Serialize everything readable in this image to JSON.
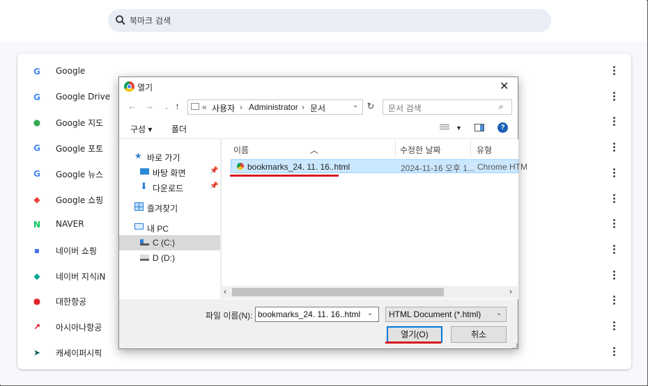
{
  "search": {
    "placeholder": "북마크 검색"
  },
  "bookmarks": [
    {
      "label": "Google",
      "icon": "google-icon",
      "glyph": "G",
      "color": "#4285f4"
    },
    {
      "label": "Google Drive",
      "icon": "google-icon",
      "glyph": "G",
      "color": "#4285f4"
    },
    {
      "label": "Google 지도",
      "icon": "google-maps-icon",
      "glyph": "●",
      "color": "#34a853"
    },
    {
      "label": "Google 포토",
      "icon": "google-icon",
      "glyph": "G",
      "color": "#4285f4"
    },
    {
      "label": "Google 뉴스",
      "icon": "google-news-icon",
      "glyph": "G",
      "color": "#4285f4"
    },
    {
      "label": "Google 쇼핑",
      "icon": "google-shopping-icon",
      "glyph": "◆",
      "color": "#ea4335"
    },
    {
      "label": "NAVER",
      "icon": "naver-icon",
      "glyph": "N",
      "color": "#03c75a"
    },
    {
      "label": "네이버 쇼핑",
      "icon": "naver-shopping-icon",
      "glyph": "▪",
      "color": "#4c6ef5"
    },
    {
      "label": "네이버 지식iN",
      "icon": "naver-kin-icon",
      "glyph": "◆",
      "color": "#00a495"
    },
    {
      "label": "대한항공",
      "icon": "korean-air-icon",
      "glyph": "●",
      "color": "#e0262f"
    },
    {
      "label": "아시아나항공",
      "icon": "asiana-icon",
      "glyph": "↗",
      "color": "#e60012"
    },
    {
      "label": "캐세이퍼시픽",
      "icon": "cathay-icon",
      "glyph": "➤",
      "color": "#006564"
    }
  ],
  "dialog": {
    "title": "열기",
    "breadcrumb": {
      "prefix": "«",
      "parts": [
        "사용자",
        "Administrator",
        "문서"
      ]
    },
    "search_placeholder": "문서 검색",
    "toolbar": {
      "organize": "구성 ▾",
      "new_folder": "폴더"
    },
    "nav": {
      "quick_access": "바로 가기",
      "desktop": "바탕 화면",
      "downloads": "다운로드",
      "favorites": "즐겨찾기",
      "this_pc": "내 PC",
      "drive_c": "C (C:)",
      "drive_d": "D (D:)"
    },
    "columns": {
      "name": "이름",
      "modified": "수정한 날짜",
      "type": "유형"
    },
    "file": {
      "name": "bookmarks_24. 11. 16..html",
      "modified": "2024-11-16 오후 1...",
      "type": "Chrome HTM"
    },
    "filename_label": "파일 이름(N):",
    "filename_value": "bookmarks_24. 11. 16..html",
    "filetype_value": "HTML Document (*.html)",
    "open_button": "열기(O)",
    "cancel_button": "취소"
  },
  "colors": {
    "highlight_underline": "#d71920",
    "selection": "#cce8ff"
  }
}
